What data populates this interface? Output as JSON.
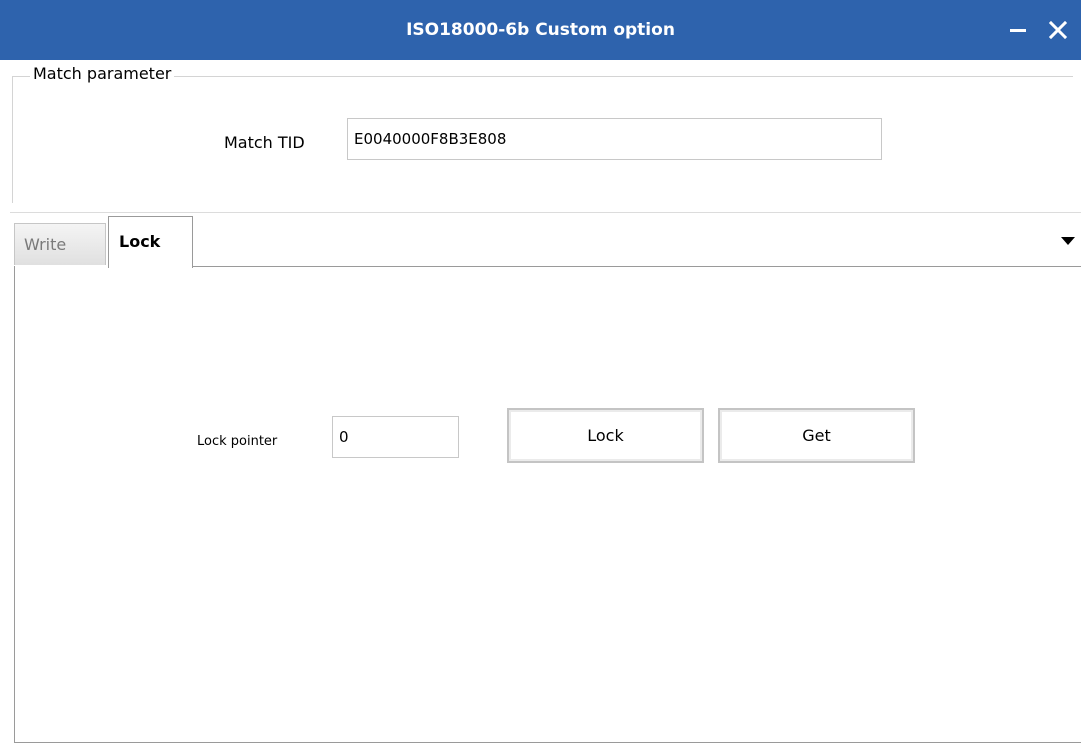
{
  "window": {
    "title": "ISO18000-6b Custom option"
  },
  "match_parameter": {
    "legend": "Match parameter",
    "tid_label": "Match TID",
    "tid_value": "E0040000F8B3E808"
  },
  "tabs": [
    {
      "label": "Write",
      "active": false
    },
    {
      "label": "Lock",
      "active": true
    }
  ],
  "lock_tab": {
    "pointer_label": "Lock pointer",
    "pointer_value": "0",
    "lock_button": "Lock",
    "get_button": "Get"
  },
  "colors": {
    "titlebar": "#2e63ad",
    "border": "#9a9a9a"
  },
  "icons": {
    "minimize": "minimize-icon",
    "close": "close-icon",
    "dropdown": "dropdown-arrow-icon"
  }
}
